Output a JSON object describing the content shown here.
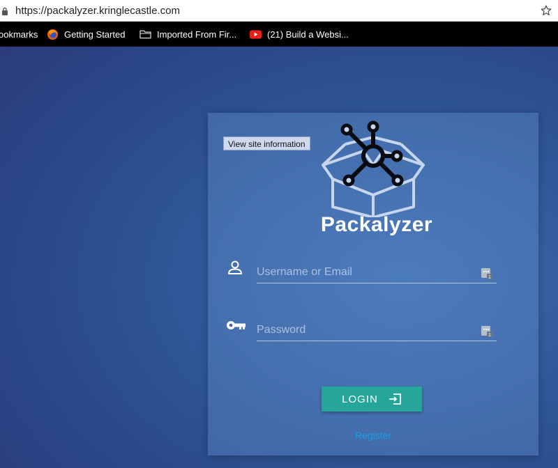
{
  "browser": {
    "url": "https://packalyzer.kringlecastle.com",
    "bookmarks": [
      {
        "label": "ookmarks",
        "icon": "bookmarks-folder-icon"
      },
      {
        "label": "Getting Started",
        "icon": "firefox-icon"
      },
      {
        "label": "Imported From Fir...",
        "icon": "folder-icon"
      },
      {
        "label": "(21) Build a Websi...",
        "icon": "youtube-icon"
      }
    ]
  },
  "tooltip": {
    "text": "View site information"
  },
  "app": {
    "name": "Packalyzer"
  },
  "form": {
    "username_placeholder": "Username or Email",
    "password_placeholder": "Password",
    "login_label": "LOGIN",
    "register_label": "Register"
  },
  "colors": {
    "button": "#26a69a",
    "link": "#1e9be6",
    "background": "#2f5696"
  }
}
